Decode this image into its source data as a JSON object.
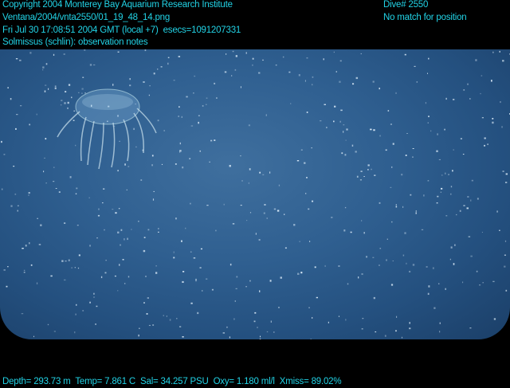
{
  "header": {
    "copyright": "Copyright 2004 Monterey Bay Aquarium Research Institute",
    "filename": "Ventana/2004/vnta2550/01_19_48_14.png",
    "datetime": "Fri Jul 30 17:08:51 2004 GMT (local +7)  esecs=1091207331",
    "annotation": "Solmissus (schlin): observation notes",
    "dive": "Dive# 2550",
    "position": "No match for position"
  },
  "footer": {
    "telemetry": "Depth= 293.73 m  Temp= 7.861 C  Sal= 34.257 PSU  Oxy= 1.180 ml/l  Xmiss= 89.02%"
  },
  "colors": {
    "overlay_text": "#22d3e6",
    "water": "#2f5f90"
  }
}
